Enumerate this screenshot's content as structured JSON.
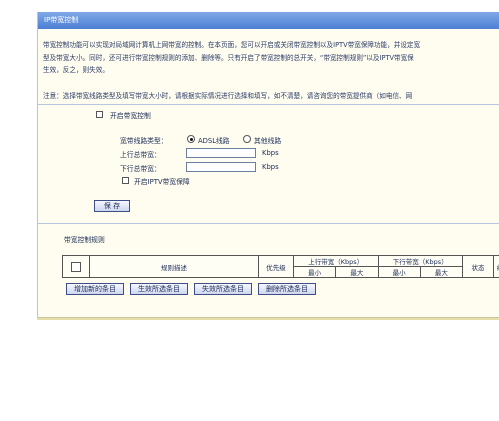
{
  "panel": {
    "title": "IP带宽控制",
    "intro_line1": "带宽控制功能可以实现对局域网计算机上网带宽的控制。在本页面，您可以开启或关闭带宽控制以及IPTV带宽保障功能，并设定宽",
    "intro_line2": "型及带宽大小。同时，还可进行带宽控制规则的添加、删除等。只有开启了带宽控制的总开关，“带宽控制规则”以及IPTV带宽保",
    "intro_line3": "生效，反之，则失效。",
    "note": "注意：选择带宽线路类型及填写带宽大小时，请根据实际情况进行选择和填写，如不清楚，请咨询您的带宽提供商（如电信、网"
  },
  "settings": {
    "enable_label": "开启带宽控制",
    "line_type_label": "宽带线路类型：",
    "line_options": [
      "ADSL线路",
      "其他线路"
    ],
    "selected_line": "ADSL线路",
    "upload_label": "上行总带宽：",
    "upload_value": "",
    "download_label": "下行总带宽：",
    "download_value": "",
    "unit": "Kbps",
    "iptv_label": "开启IPTV带宽保障",
    "save_label": "保 存"
  },
  "rules": {
    "section_title": "带宽控制规则",
    "col_desc": "规则描述",
    "col_priority": "优先级",
    "col_upload": "上行带宽（Kbps）",
    "col_download": "下行带宽（Kbps）",
    "col_min": "最小",
    "col_max": "最大",
    "col_status": "状态",
    "col_edit": "编"
  },
  "actions": {
    "add": "增加新的条目",
    "enable_selected": "生效所选条目",
    "disable_selected": "失效所选条目",
    "delete_selected": "删除所选条目"
  }
}
